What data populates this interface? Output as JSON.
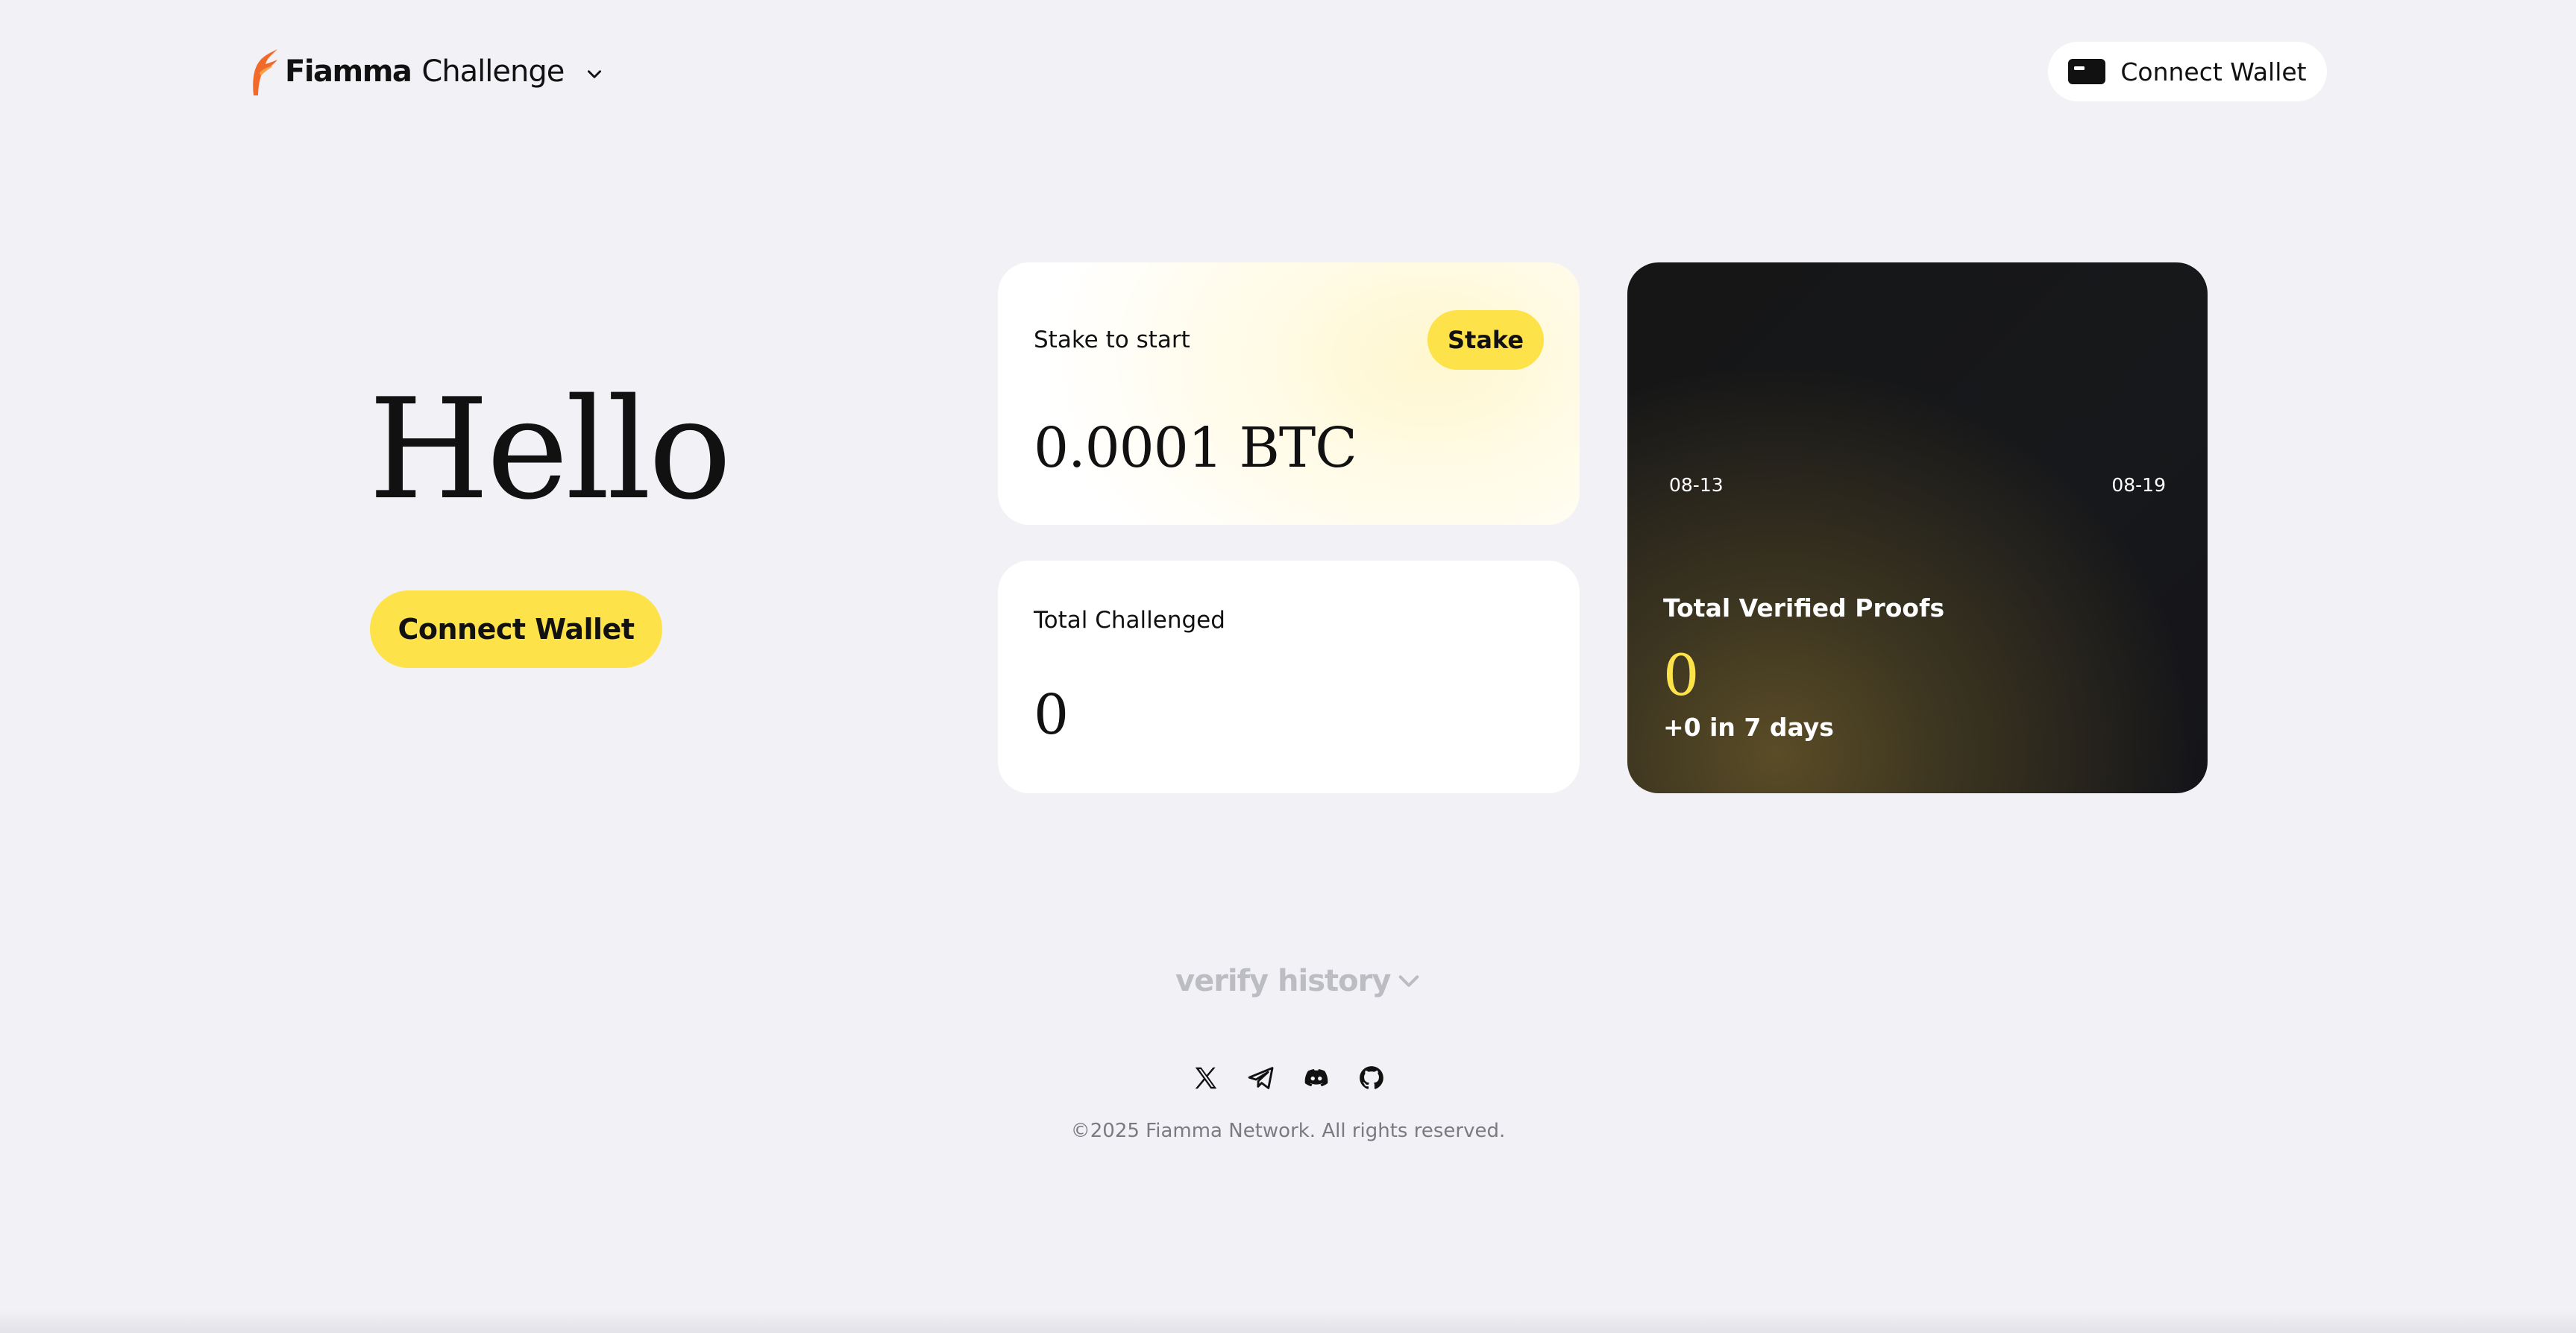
{
  "header": {
    "brand": "Fiamma",
    "product": "Challenge",
    "menu_icon": "chevron-down-icon",
    "connect_wallet_label": "Connect Wallet",
    "wallet_icon": "wallet-icon"
  },
  "hero": {
    "greeting": "Hello",
    "connect_wallet_label": "Connect Wallet"
  },
  "stake_card": {
    "label": "Stake to start",
    "button_label": "Stake",
    "amount": "0.0001 BTC"
  },
  "challenged_card": {
    "label": "Total Challenged",
    "value": "0"
  },
  "proofs_card": {
    "date_start": "08-13",
    "date_end": "08-19",
    "label": "Total Verified Proofs",
    "value": "0",
    "delta": "+0 in 7 days"
  },
  "history": {
    "toggle_label": "verify history"
  },
  "footer": {
    "social_icons": [
      "x-icon",
      "telegram-icon",
      "discord-icon",
      "github-icon"
    ],
    "copyright": "©2025 Fiamma Network. All rights reserved."
  },
  "colors": {
    "accent": "#fde24a",
    "background": "#f2f1f6",
    "logo": "#f26a2a",
    "dark_card": "#161616"
  }
}
